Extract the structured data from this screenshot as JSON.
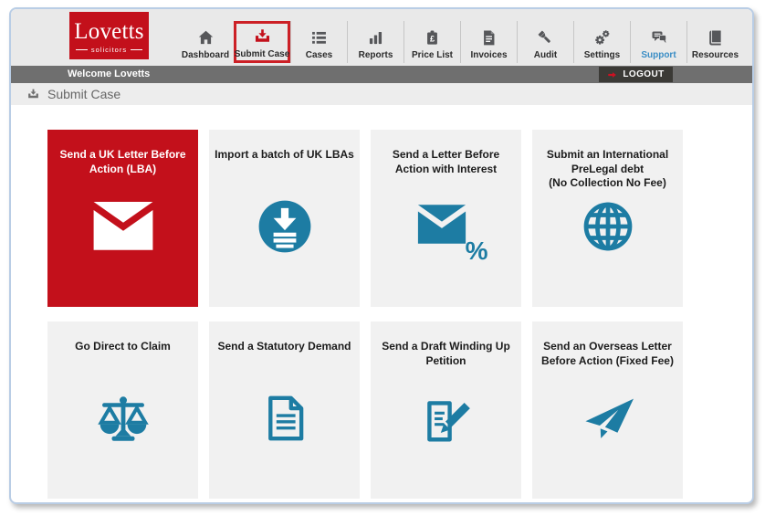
{
  "brand": {
    "name": "Lovetts",
    "tagline": "solicitors"
  },
  "nav": {
    "price_glyph": "£",
    "items": [
      {
        "label": "Dashboard",
        "icon": "home-icon",
        "active": false
      },
      {
        "label": "Submit Case",
        "icon": "submit-case-icon",
        "active": true
      },
      {
        "label": "Cases",
        "icon": "cases-list-icon",
        "active": false
      },
      {
        "label": "Reports",
        "icon": "bar-chart-icon",
        "active": false
      },
      {
        "label": "Price List",
        "icon": "price-tag-icon",
        "active": false
      },
      {
        "label": "Invoices",
        "icon": "invoice-icon",
        "active": false
      },
      {
        "label": "Audit",
        "icon": "flashlight-icon",
        "active": false
      },
      {
        "label": "Settings",
        "icon": "gears-icon",
        "active": false
      },
      {
        "label": "Support",
        "icon": "chat-bubbles-icon",
        "active": false,
        "highlighted": true
      },
      {
        "label": "Resources",
        "icon": "book-icon",
        "active": false
      }
    ]
  },
  "welcome_bar": {
    "text": "Welcome Lovetts",
    "logout_label": "LOGOUT"
  },
  "breadcrumb": {
    "label": "Submit Case"
  },
  "tiles": [
    {
      "title": "Send a UK Letter Before Action (LBA)",
      "icon": "envelope-icon",
      "selected": true
    },
    {
      "title": "Import a batch of UK LBAs",
      "icon": "batch-import-icon",
      "selected": false
    },
    {
      "title": "Send a Letter Before Action with Interest",
      "icon": "envelope-percent-icon",
      "percent": "%",
      "selected": false
    },
    {
      "title": "Submit an International PreLegal debt\n(No Collection No Fee)",
      "icon": "globe-icon",
      "selected": false
    },
    {
      "title": "Go Direct to Claim",
      "icon": "scales-icon",
      "selected": false
    },
    {
      "title": "Send a Statutory Demand",
      "icon": "document-icon",
      "selected": false
    },
    {
      "title": "Send a Draft Winding Up Petition",
      "icon": "document-pencil-icon",
      "selected": false
    },
    {
      "title": "Send an Overseas Letter Before Action (Fixed Fee)",
      "icon": "paper-plane-icon",
      "selected": false
    }
  ],
  "colors": {
    "accent_red": "#c3101b",
    "active_border_red": "#cc2026",
    "icon_teal": "#1d7ca3",
    "support_blue": "#3a8dc5",
    "nav_icon_gray": "#56575a",
    "welcome_bar_gray": "#6f6f6f",
    "logout_bg": "#3b3a36"
  }
}
